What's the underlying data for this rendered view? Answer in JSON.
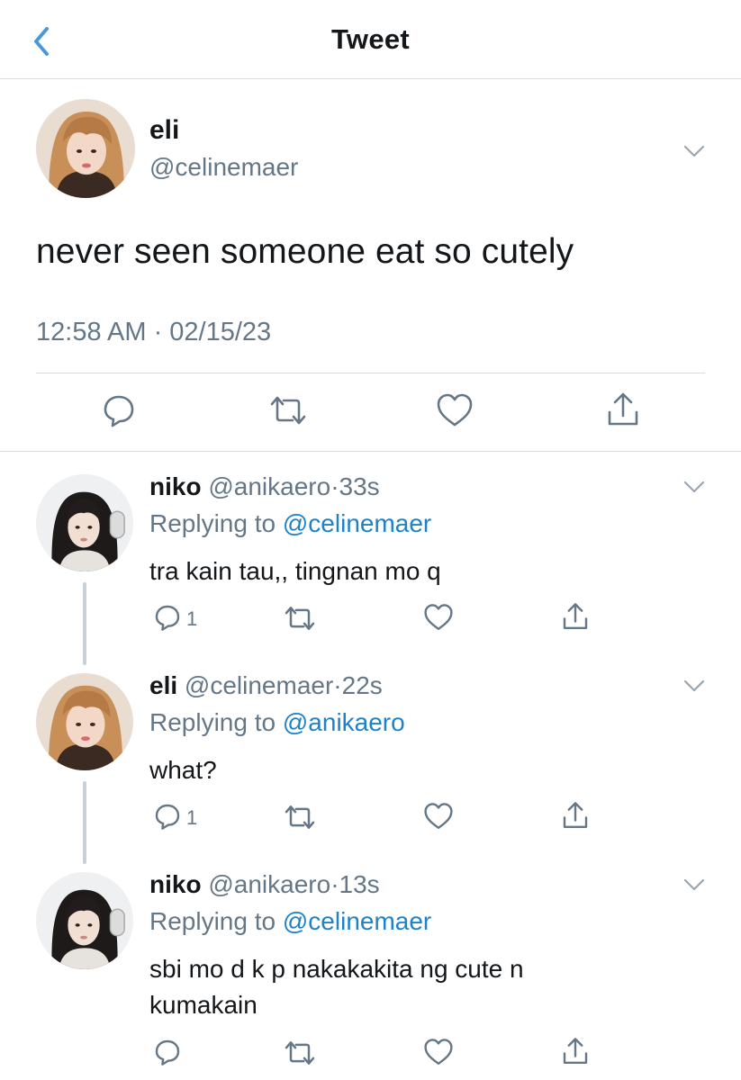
{
  "header": {
    "title": "Tweet",
    "back_icon": "chevron-left-icon",
    "accent": "#1da1f2"
  },
  "tweet": {
    "name": "eli",
    "handle": "@celinemaer",
    "text": "never seen someone eat so cutely",
    "timestamp": "12:58 AM · 02/15/23",
    "actions": [
      "comment-icon",
      "retweet-icon",
      "like-icon",
      "share-icon"
    ]
  },
  "replies": [
    {
      "name": "niko",
      "handle": "@anikaero",
      "dot": "·",
      "time": "33s",
      "replying_label": "Replying to",
      "replying_to": "@celinemaer",
      "text": "tra kain tau,, tingnan mo q",
      "reply_count": "1"
    },
    {
      "name": "eli",
      "handle": "@celinemaer",
      "dot": "·",
      "time": "22s",
      "replying_label": "Replying to",
      "replying_to": "@anikaero",
      "text": "what?",
      "reply_count": "1"
    },
    {
      "name": "niko",
      "handle": "@anikaero",
      "dot": "·",
      "time": "13s",
      "replying_label": "Replying to",
      "replying_to": "@celinemaer",
      "text": "sbi mo d k p nakakakita ng cute n kumakain",
      "reply_count": ""
    }
  ],
  "colors": {
    "text": "#14171a",
    "secondary": "#657786",
    "link": "#1d82c8",
    "divider": "#d8dde1"
  }
}
